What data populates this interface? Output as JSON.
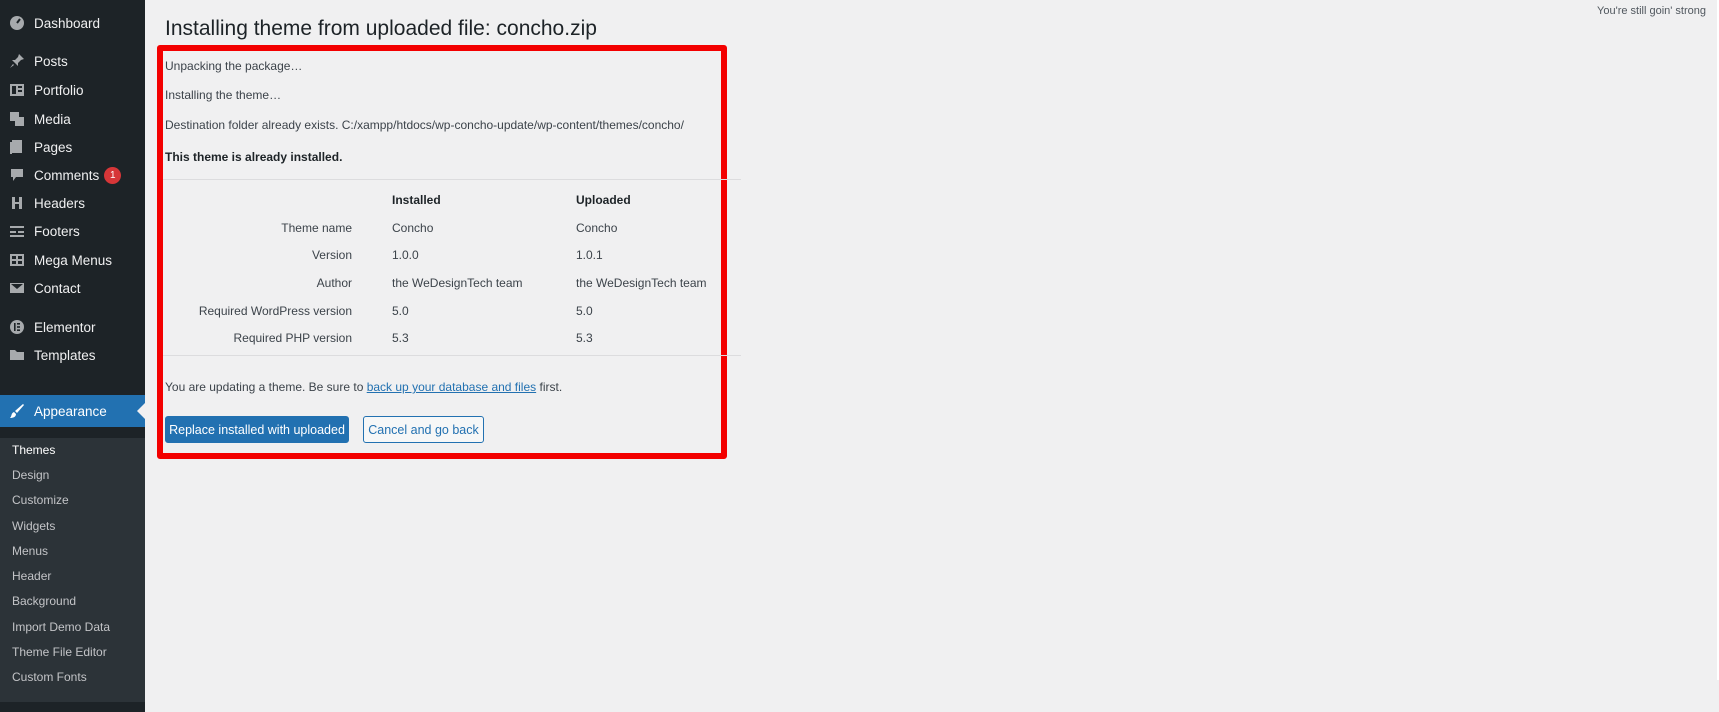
{
  "top_note": "You're still goin' strong",
  "page_title": "Installing theme from uploaded file: concho.zip",
  "sidebar": {
    "items": [
      {
        "label": "Dashboard",
        "icon": "dashboard-icon"
      },
      {
        "label": "Posts",
        "icon": "pin-icon"
      },
      {
        "label": "Portfolio",
        "icon": "portfolio-icon"
      },
      {
        "label": "Media",
        "icon": "media-icon"
      },
      {
        "label": "Pages",
        "icon": "pages-icon"
      },
      {
        "label": "Comments",
        "icon": "comment-icon",
        "badge": "1"
      },
      {
        "label": "Headers",
        "icon": "headers-icon"
      },
      {
        "label": "Footers",
        "icon": "footers-icon"
      },
      {
        "label": "Mega Menus",
        "icon": "table-icon"
      },
      {
        "label": "Contact",
        "icon": "envelope-icon"
      },
      {
        "label": "Elementor",
        "icon": "elementor-icon"
      },
      {
        "label": "Templates",
        "icon": "folder-icon"
      },
      {
        "label": "Appearance",
        "icon": "brush-icon",
        "active": true
      }
    ],
    "submenu": [
      "Themes",
      "Design",
      "Customize",
      "Widgets",
      "Menus",
      "Header",
      "Background",
      "Import Demo Data",
      "Theme File Editor",
      "Custom Fonts"
    ]
  },
  "messages": {
    "unpacking": "Unpacking the package…",
    "installing": "Installing the theme…",
    "destination": "Destination folder already exists. C:/xampp/htdocs/wp-concho-update/wp-content/themes/concho/",
    "already_installed": "This theme is already installed."
  },
  "compare_table": {
    "headers": {
      "installed": "Installed",
      "uploaded": "Uploaded"
    },
    "rows": [
      {
        "label": "Theme name",
        "installed": "Concho",
        "uploaded": "Concho"
      },
      {
        "label": "Version",
        "installed": "1.0.0",
        "uploaded": "1.0.1"
      },
      {
        "label": "Author",
        "installed": "the WeDesignTech team",
        "uploaded": "the WeDesignTech team"
      },
      {
        "label": "Required WordPress version",
        "installed": "5.0",
        "uploaded": "5.0"
      },
      {
        "label": "Required PHP version",
        "installed": "5.3",
        "uploaded": "5.3"
      }
    ]
  },
  "update_note": {
    "before": "You are updating a theme. Be sure to ",
    "link": "back up your database and files",
    "after": " first."
  },
  "buttons": {
    "replace": "Replace installed with uploaded",
    "cancel": "Cancel and go back"
  },
  "colors": {
    "sidebar_bg": "#1d2327",
    "submenu_bg": "#2c3338",
    "accent": "#2271b1",
    "highlight_border": "#f30000",
    "badge": "#d63638"
  }
}
